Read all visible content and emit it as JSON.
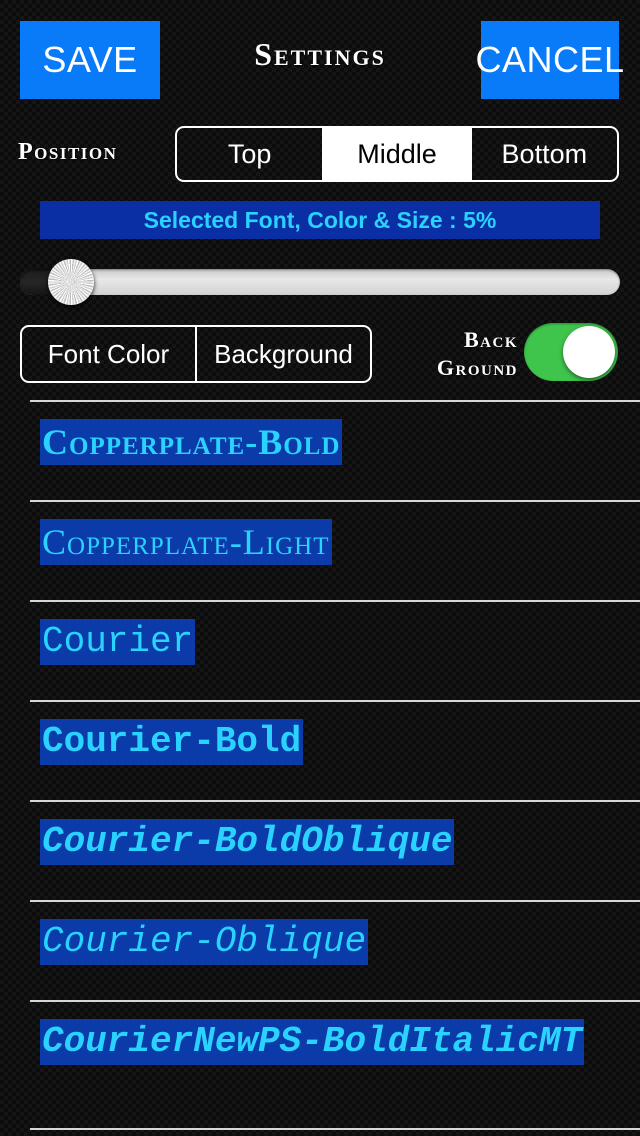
{
  "header": {
    "save_label": "SAVE",
    "title": "Settings",
    "cancel_label": "CANCEL"
  },
  "position": {
    "label": "Position",
    "options": [
      "Top",
      "Middle",
      "Bottom"
    ],
    "selected": "Middle"
  },
  "selected_info": {
    "text": "Selected Font, Color & Size : 5%",
    "size_percent": 5
  },
  "slider": {
    "value_percent": 5
  },
  "color_mode": {
    "options": [
      "Font Color",
      "Background"
    ],
    "selected": ""
  },
  "background_toggle": {
    "label_line1": "Back",
    "label_line2": "Ground",
    "state": "on"
  },
  "font_list": [
    {
      "name": "Copperplate-Bold",
      "style": "f-copperplate bold"
    },
    {
      "name": "Copperplate-Light",
      "style": "f-copperplate"
    },
    {
      "name": "Courier",
      "style": "f-mono"
    },
    {
      "name": "Courier-Bold",
      "style": "f-mono bold"
    },
    {
      "name": "Courier-BoldOblique",
      "style": "f-mono bold italic"
    },
    {
      "name": "Courier-Oblique",
      "style": "f-mono italic"
    },
    {
      "name": "CourierNewPS-BoldItalicMT",
      "style": "f-mono bold italic"
    }
  ],
  "colors": {
    "accent_blue": "#0a7bf8",
    "info_bar_blue": "#0a2fa5",
    "highlight_blue": "#0a3ba8",
    "cyan_text": "#2ad2ff",
    "toggle_green": "#3fc44c",
    "background": "#161616"
  }
}
